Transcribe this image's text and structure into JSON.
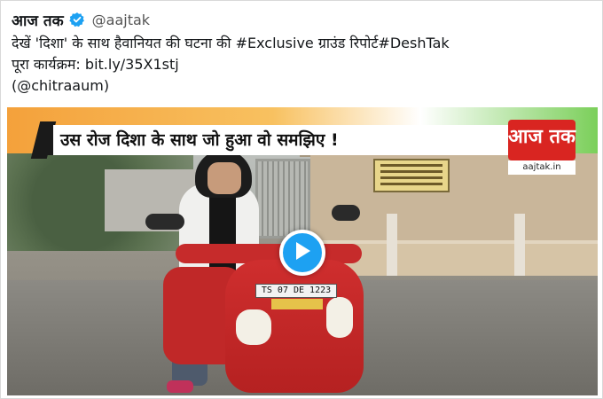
{
  "tweet": {
    "display_name": "आज तक",
    "handle": "@aajtak",
    "text_line1_prefix": "देखें 'दिशा' के साथ हैवानियत की घटना की ",
    "hashtag1": "#Exclusive",
    "text_line1_mid": " ग्राउंड रिपोर्ट",
    "hashtag2": "#DeshTak",
    "text_line2": "पूरा कार्यक्रम: bit.ly/35X1stj",
    "text_line3": "(@chitraaum)"
  },
  "video": {
    "headline": "उस रोज दिशा के साथ जो हुआ वो समझिए !",
    "logo_text": "आज तक",
    "logo_sub": "aajtak.in",
    "plate_text": "TS 07 DE 1223"
  },
  "colors": {
    "play_button": "#1da1f2",
    "verified_badge": "#1da1f2",
    "logo_red": "#d92521"
  },
  "icons": {
    "verified": "verified-badge-icon",
    "play": "play-icon"
  }
}
